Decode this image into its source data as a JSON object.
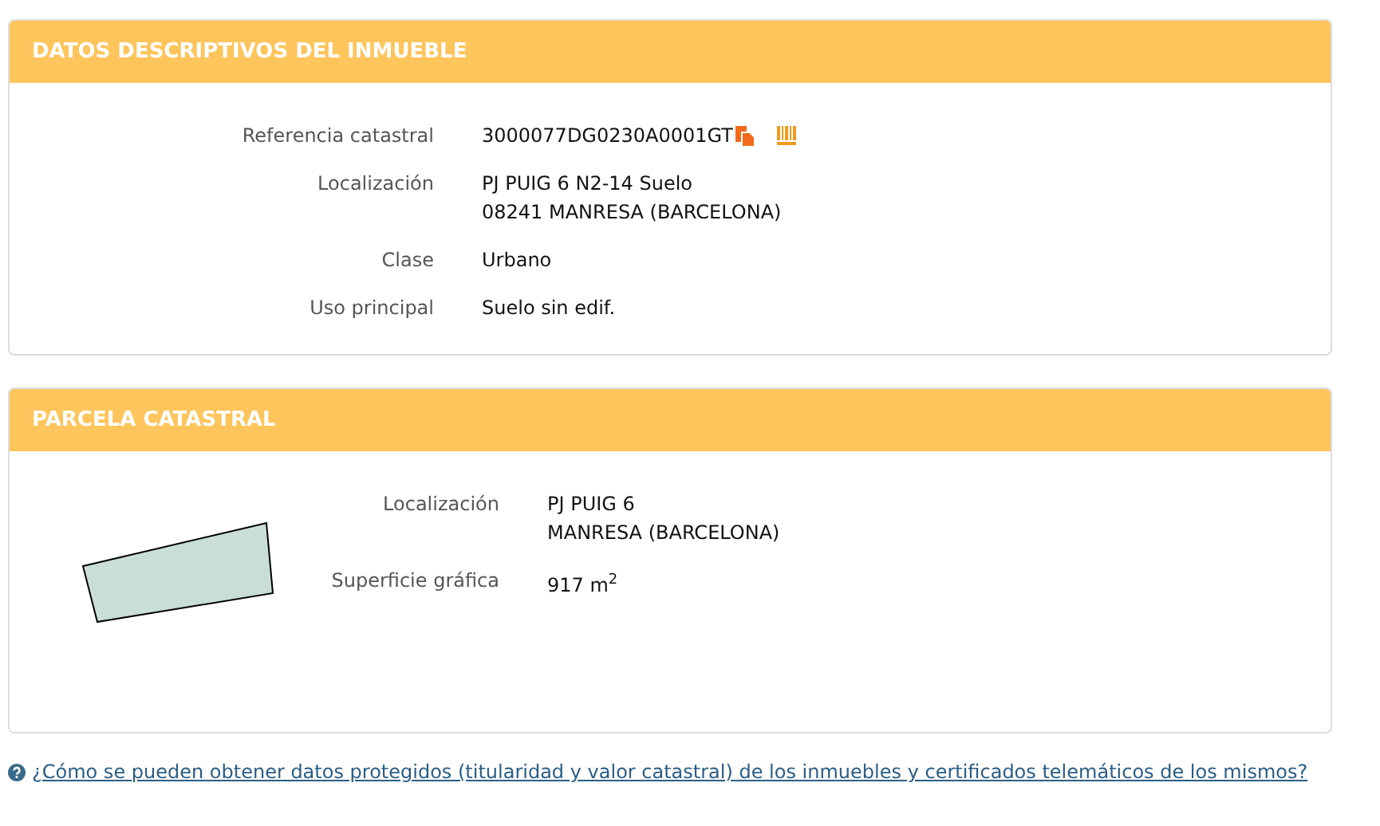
{
  "sections": [
    {
      "title": "DATOS DESCRIPTIVOS DEL INMUEBLE",
      "kind": "fields",
      "fields": [
        {
          "label": "Referencia catastral",
          "lines": [
            "3000077DG0230A0001GT"
          ],
          "actions": true
        },
        {
          "label": "Localización",
          "lines": [
            "PJ PUIG 6 N2-14 Suelo",
            "08241 MANRESA (BARCELONA)"
          ]
        },
        {
          "label": "Clase",
          "lines": [
            "Urbano"
          ]
        },
        {
          "label": "Uso principal",
          "lines": [
            "Suelo sin edif."
          ]
        }
      ]
    },
    {
      "title": "PARCELA CATASTRAL",
      "kind": "parcel",
      "fields": [
        {
          "label": "Localización",
          "lines": [
            "PJ PUIG 6",
            "MANRESA (BARCELONA)"
          ]
        },
        {
          "label": "Superficie gráfica",
          "lines": [
            "917 m$^{2}$"
          ]
        }
      ]
    }
  ],
  "help_link": "¿Cómo se pueden obtener datos protegidos (titularidad y valor catastral) de los inmuebles y certificados telemáticos de los mismos?"
}
